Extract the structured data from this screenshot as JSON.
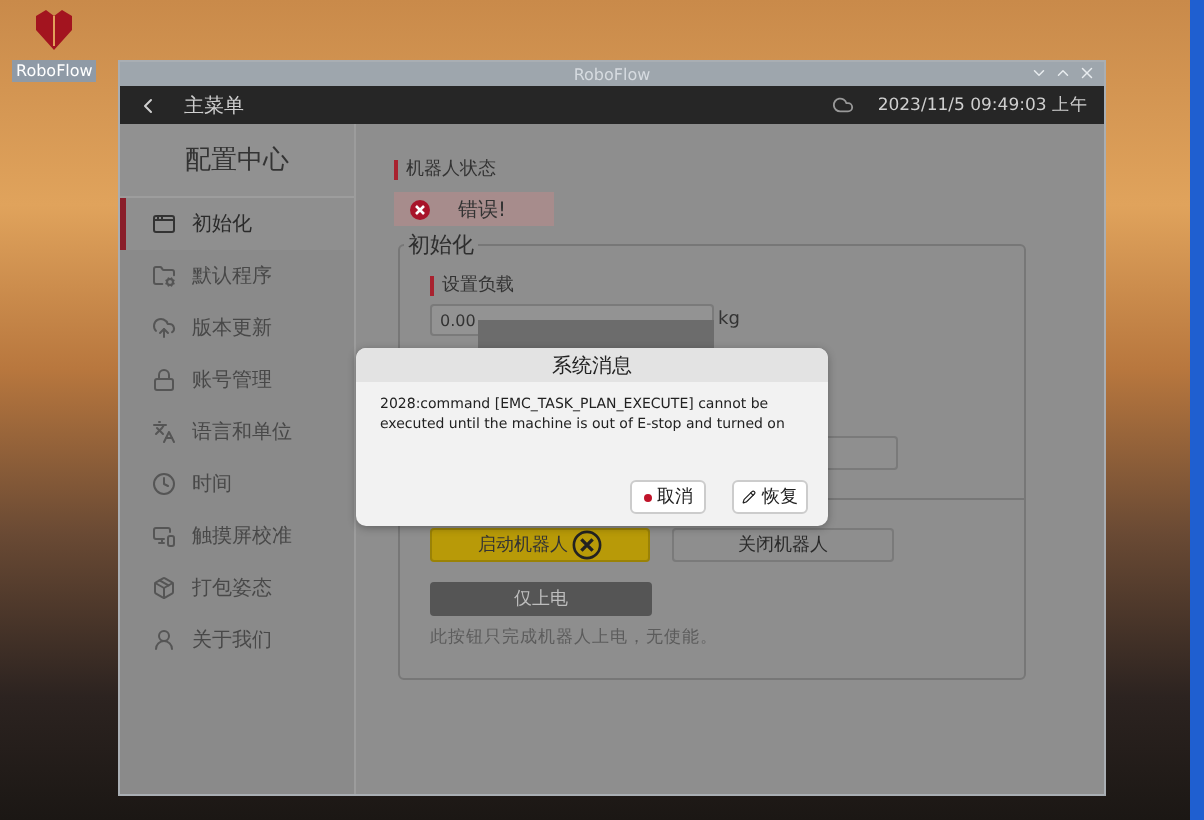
{
  "desktop": {
    "icon_label": "RoboFlow"
  },
  "window": {
    "title": "RoboFlow"
  },
  "header": {
    "back_label": "主菜单",
    "datetime": "2023/11/5 09:49:03 上午"
  },
  "sidebar": {
    "title": "配置中心",
    "items": [
      {
        "label": "初始化",
        "selected": true
      },
      {
        "label": "默认程序",
        "selected": false
      },
      {
        "label": "版本更新",
        "selected": false
      },
      {
        "label": "账号管理",
        "selected": false
      },
      {
        "label": "语言和单位",
        "selected": false
      },
      {
        "label": "时间",
        "selected": false
      },
      {
        "label": "触摸屏校准",
        "selected": false
      },
      {
        "label": "打包姿态",
        "selected": false
      },
      {
        "label": "关于我们",
        "selected": false
      }
    ]
  },
  "status": {
    "label": "机器人状态",
    "value": "错误!"
  },
  "init_group": {
    "title": "初始化",
    "payload_label": "设置负载",
    "payload_value": "0.00",
    "payload_unit": "kg"
  },
  "power_buttons": [
    {
      "label": "启动机器人",
      "kind": "start"
    },
    {
      "label": "关闭机器人",
      "kind": "stop"
    },
    {
      "label": "仅上电",
      "kind": "power"
    }
  ],
  "power_hint": "此按钮只完成机器人上电，无使能。",
  "dialog": {
    "title": "系统消息",
    "message": "2028:command [EMC_TASK_PLAN_EXECUTE] cannot be executed until the machine is out of E-stop and turned on",
    "buttons": [
      {
        "label": "取消",
        "kind": "cancel"
      },
      {
        "label": "恢复",
        "kind": "recover"
      }
    ]
  }
}
